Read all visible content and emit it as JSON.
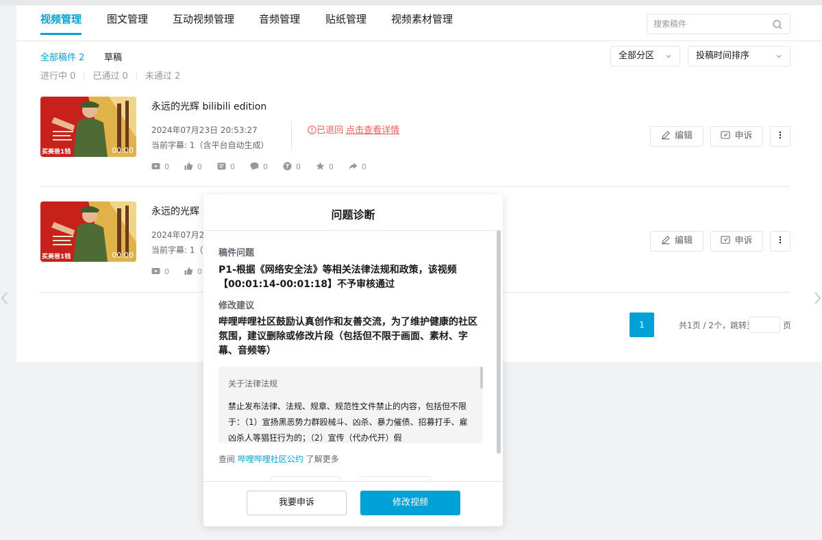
{
  "tabs": [
    "视频管理",
    "图文管理",
    "互动视频管理",
    "音频管理",
    "贴纸管理",
    "视频素材管理"
  ],
  "search": {
    "placeholder": "搜索稿件"
  },
  "subtabs": {
    "all": "全部稿件 2",
    "draft": "草稿"
  },
  "status": {
    "in_progress": "进行中 0",
    "passed": "已通过 0",
    "failed": "未通过 2"
  },
  "filters": {
    "category": "全部分区",
    "sort": "投稿时间排序"
  },
  "items": [
    {
      "title": "永远的光辉 bilibili edition",
      "date": "2024年07月23日 20:53:27",
      "subtitle": "当前字幕: 1（含平台自动生成）",
      "duration": "00:00",
      "thumb_badge": "买美爸1钱",
      "reject_text": "已退回",
      "reject_link": "点击查看详情",
      "stats": [
        "0",
        "0",
        "0",
        "0",
        "0",
        "0",
        "0"
      ]
    },
    {
      "title": "永远的光辉",
      "date": "2024年07月2",
      "subtitle": "当前字幕: 1（",
      "duration": "00:00",
      "thumb_badge": "买美爸1钱",
      "stats": [
        "0",
        "0"
      ]
    }
  ],
  "actions": {
    "edit": "编辑",
    "appeal": "申诉"
  },
  "pager": {
    "page": "1",
    "summary": "共1页 / 2个，跳转至",
    "after": "页"
  },
  "modal": {
    "title": "问题诊断",
    "issue_label": "稿件问题",
    "issue_text": "P1-根据《网络安全法》等相关法律法规和政策，该视频【00:01:14-00:01:18】不予审核通过",
    "advice_label": "修改建议",
    "advice_text": "哔哩哔哩社区鼓励认真创作和友善交流，为了维护健康的社区氛围，建议删除或修改片段（包括但不限于画面、素材、字幕、音频等）",
    "law_title": "关于法律法规",
    "law_body": "禁止发布法律、法规、规章、规范性文件禁止的内容，包括但不限于：（1）宣扬黑恶势力群殴械斗、凶杀、暴力催债、招募打手、雇凶杀人等猖狂行为的；（2）宣传（代办代开）假",
    "ref_prefix": "查阅",
    "ref_link": "哔哩哔哩社区公约",
    "ref_suffix": "了解更多",
    "appeal_btn": "我要申诉",
    "modify_btn": "修改视频"
  },
  "colors": {
    "accent": "#00a1d6",
    "danger": "#f25d59"
  }
}
